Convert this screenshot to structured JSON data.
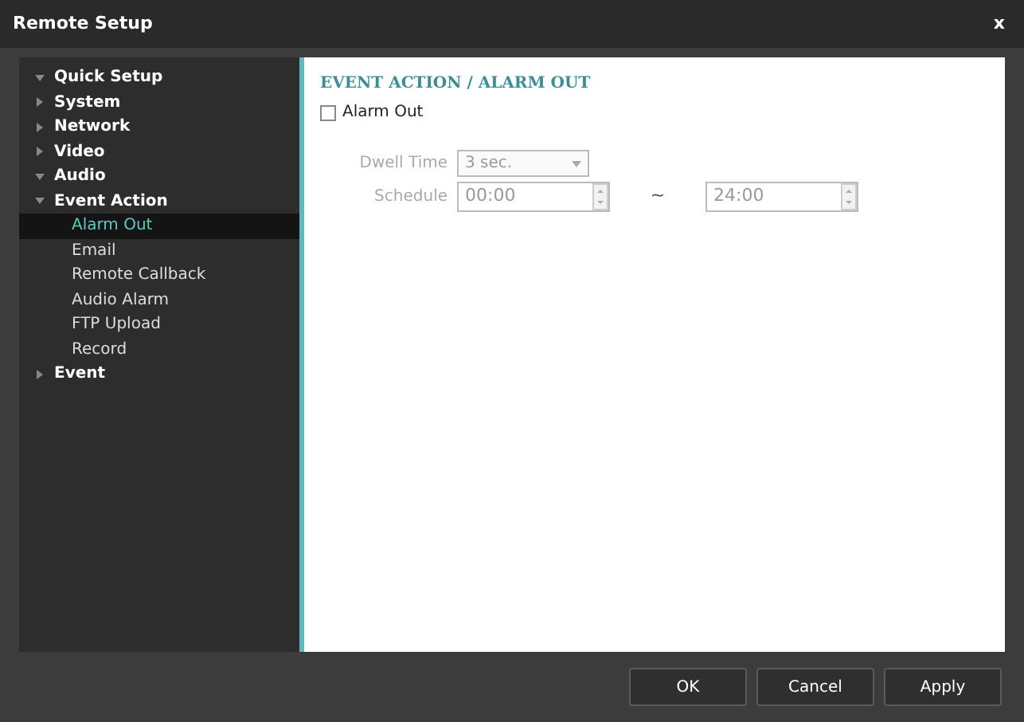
{
  "window": {
    "title": "Remote Setup",
    "close": "x"
  },
  "sidebar": {
    "items": [
      {
        "label": "Quick Setup",
        "expanded": true,
        "selected": false
      },
      {
        "label": "System",
        "expanded": false,
        "selected": false
      },
      {
        "label": "Network",
        "expanded": false,
        "selected": false
      },
      {
        "label": "Video",
        "expanded": false,
        "selected": false
      },
      {
        "label": "Audio",
        "expanded": true,
        "selected": false
      },
      {
        "label": "Event Action",
        "expanded": true,
        "selected": false,
        "children": [
          {
            "label": "Alarm Out",
            "selected": true
          },
          {
            "label": "Email",
            "selected": false
          },
          {
            "label": "Remote Callback",
            "selected": false
          },
          {
            "label": "Audio Alarm",
            "selected": false
          },
          {
            "label": "FTP Upload",
            "selected": false
          },
          {
            "label": "Record",
            "selected": false
          }
        ]
      },
      {
        "label": "Event",
        "expanded": false,
        "selected": false
      }
    ]
  },
  "content": {
    "heading": "EVENT ACTION / ALARM OUT",
    "alarm_out": {
      "label": "Alarm Out",
      "checked": false
    },
    "dwell_time": {
      "label": "Dwell Time",
      "value": "3 sec.",
      "disabled": true
    },
    "schedule": {
      "label": "Schedule",
      "from": "00:00",
      "separator": "~",
      "to": "24:00",
      "disabled": true
    }
  },
  "buttons": [
    "OK",
    "Cancel",
    "Apply"
  ]
}
